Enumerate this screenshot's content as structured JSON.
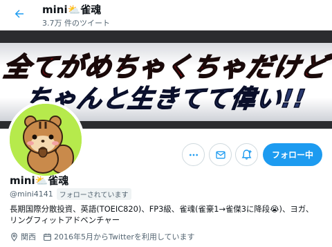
{
  "header": {
    "name": "mini⛅雀魂",
    "tweet_count": "3.7万 件のツイート"
  },
  "banner": {
    "line1": "全てがめちゃくちゃだけど",
    "line2": "ちゃんと生きてて偉い!!"
  },
  "actions": {
    "follow_label": "フォロー中"
  },
  "profile": {
    "name": "mini⛅雀魂",
    "handle": "@mini4141",
    "follows_you": "フォローされています",
    "bio_line1": "長期国際分散投資、英語(TOEIC820)、FP3級、雀魂(雀豪1→雀傑3に降段😭)、ヨガ、",
    "bio_line2": "リングフィットアドベンチャー",
    "location": "関西",
    "joined": "2016年5月からTwitterを利用しています"
  },
  "colors": {
    "accent": "#1d9bf0",
    "banner_red": "#e10012",
    "avatar_bg": "#b6ea4c"
  }
}
